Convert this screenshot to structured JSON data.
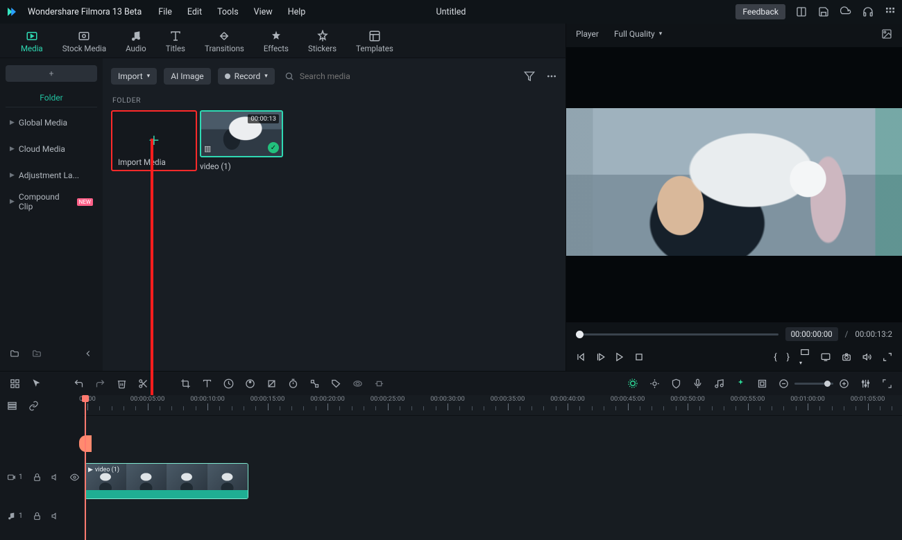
{
  "app": {
    "name": "Wondershare Filmora 13 Beta",
    "doc_title": "Untitled",
    "feedback": "Feedback"
  },
  "menu": [
    "File",
    "Edit",
    "Tools",
    "View",
    "Help"
  ],
  "tabs": [
    {
      "label": "Media",
      "active": true
    },
    {
      "label": "Stock Media"
    },
    {
      "label": "Audio"
    },
    {
      "label": "Titles"
    },
    {
      "label": "Transitions"
    },
    {
      "label": "Effects"
    },
    {
      "label": "Stickers"
    },
    {
      "label": "Templates"
    }
  ],
  "sidebar": {
    "folder_label": "Folder",
    "items": [
      {
        "label": "Global Media"
      },
      {
        "label": "Cloud Media"
      },
      {
        "label": "Adjustment La..."
      },
      {
        "label": "Compound Clip",
        "badge": "NEW"
      }
    ]
  },
  "media": {
    "import": "Import",
    "ai_image": "AI Image",
    "record": "Record",
    "search_placeholder": "Search media",
    "section": "FOLDER",
    "import_card": "Import Media",
    "clip": {
      "name": "video (1)",
      "duration": "00:00:13"
    }
  },
  "player": {
    "tab": "Player",
    "quality": "Full Quality",
    "current": "00:00:00:00",
    "total": "00:00:13:2",
    "slash": "/"
  },
  "ruler": {
    "labels": [
      "00:00",
      "00:00:05:00",
      "00:00:10:00",
      "00:00:15:00",
      "00:00:20:00",
      "00:00:25:00",
      "00:00:30:00",
      "00:00:35:00",
      "00:00:40:00",
      "00:00:45:00",
      "00:00:50:00",
      "00:00:55:00",
      "00:01:00:00",
      "00:01:05:00"
    ]
  },
  "track": {
    "video": "1",
    "audio": "1"
  },
  "clip_overlay": "video (1)"
}
